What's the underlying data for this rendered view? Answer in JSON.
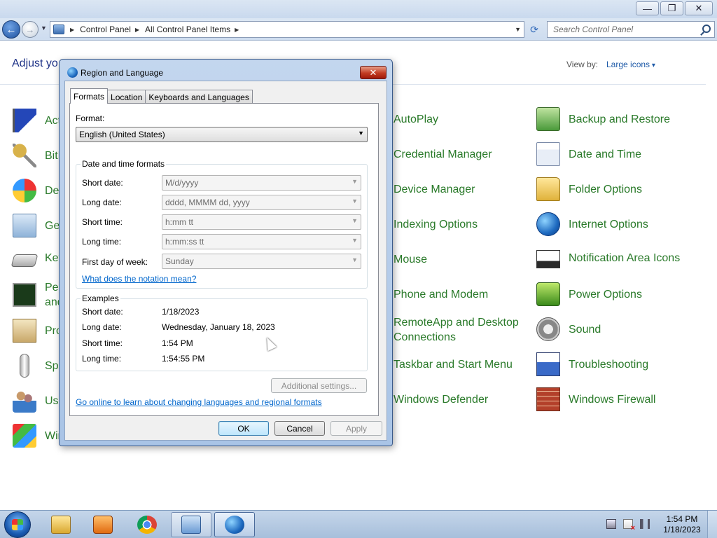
{
  "window": {
    "minimize_glyph": "—",
    "maximize_glyph": "❐",
    "close_glyph": "✕"
  },
  "navbar": {
    "back_glyph": "←",
    "forward_glyph": "→",
    "breadcrumbs": [
      "Control Panel",
      "All Control Panel Items"
    ],
    "search_placeholder": "Search Control Panel",
    "refresh_glyph": "⟳"
  },
  "control_panel": {
    "heading": "Adjust yo",
    "view_by_label": "View by:",
    "view_by_value": "Large icons",
    "left_column": [
      "Act",
      "BitL",
      "Def",
      "Get",
      "Key",
      "Per\nand",
      "Pro",
      "Spe",
      "Use",
      "Wir"
    ],
    "middle_column": [
      "AutoPlay",
      "Credential Manager",
      "Device Manager",
      "Indexing Options",
      "Mouse",
      "Phone and Modem",
      "RemoteApp and Desktop\nConnections",
      "Taskbar and Start Menu",
      "Windows Defender"
    ],
    "right_column": [
      "Backup and Restore",
      "Date and Time",
      "Folder Options",
      "Internet Options",
      "Notification Area Icons",
      "Power Options",
      "Sound",
      "Troubleshooting",
      "Windows Firewall"
    ],
    "label_color": "#2a7a2a"
  },
  "dialog": {
    "title": "Region and Language",
    "close_glyph": "✕",
    "tabs": [
      "Formats",
      "Location",
      "Keyboards and Languages"
    ],
    "active_tab": "Formats",
    "format_label": "Format:",
    "format_value": "English (United States)",
    "date_time_group": "Date and time formats",
    "short_date_label": "Short date:",
    "short_date_value": "M/d/yyyy",
    "long_date_label": "Long date:",
    "long_date_value": "dddd, MMMM dd, yyyy",
    "short_time_label": "Short time:",
    "short_time_value": "h:mm tt",
    "long_time_label": "Long time:",
    "long_time_value": "h:mm:ss tt",
    "first_day_label": "First day of week:",
    "first_day_value": "Sunday",
    "notation_link": "What does the notation mean?",
    "examples_group": "Examples",
    "examples": {
      "short_date_label": "Short date:",
      "short_date_value": "1/18/2023",
      "long_date_label": "Long date:",
      "long_date_value": "Wednesday, January 18, 2023",
      "short_time_label": "Short time:",
      "short_time_value": "1:54 PM",
      "long_time_label": "Long time:",
      "long_time_value": "1:54:55 PM"
    },
    "additional_settings": "Additional settings...",
    "online_link": "Go online to learn about changing languages and regional formats",
    "ok": "OK",
    "cancel": "Cancel",
    "apply": "Apply"
  },
  "taskbar": {
    "time": "1:54 PM",
    "date": "1/18/2023"
  }
}
